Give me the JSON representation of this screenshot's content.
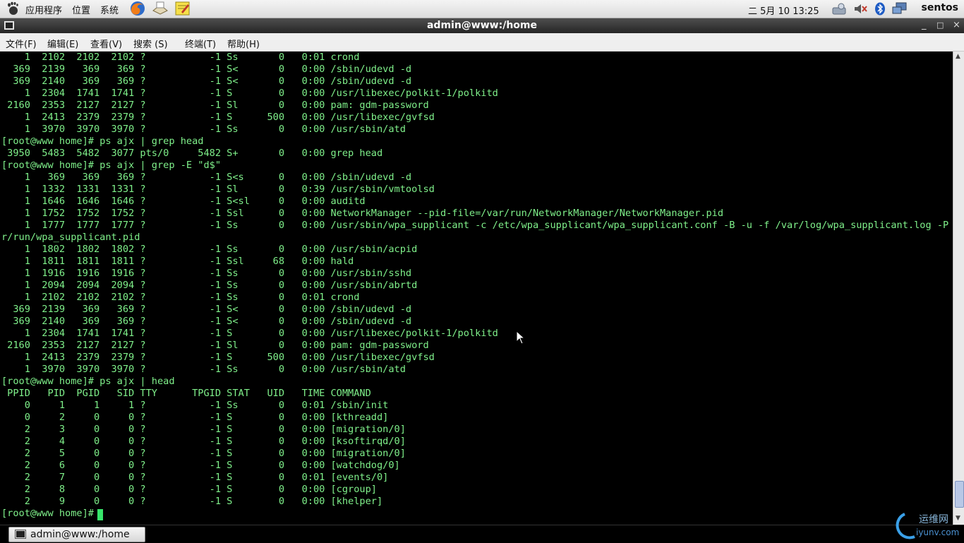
{
  "top_panel": {
    "menus": [
      "应用程序",
      "位置",
      "系统"
    ],
    "clock": "二 5月 10 13:25",
    "user": "sentos"
  },
  "window": {
    "title": "admin@www:/home",
    "controls": [
      "_",
      "□",
      "×"
    ]
  },
  "menubar": {
    "items": [
      "文件(F)",
      "编辑(E)",
      "查看(V)",
      "搜索 (S)",
      "终端(T)",
      "帮助(H)"
    ]
  },
  "terminal": {
    "lines": [
      "    1  2102  2102  2102 ?           -1 Ss       0   0:01 crond",
      "  369  2139   369   369 ?           -1 S<       0   0:00 /sbin/udevd -d",
      "  369  2140   369   369 ?           -1 S<       0   0:00 /sbin/udevd -d",
      "    1  2304  1741  1741 ?           -1 S        0   0:00 /usr/libexec/polkit-1/polkitd",
      " 2160  2353  2127  2127 ?           -1 Sl       0   0:00 pam: gdm-password",
      "    1  2413  2379  2379 ?           -1 S      500   0:00 /usr/libexec/gvfsd",
      "    1  3970  3970  3970 ?           -1 Ss       0   0:00 /usr/sbin/atd",
      "[root@www home]# ps ajx | grep head",
      " 3950  5483  5482  3077 pts/0     5482 S+       0   0:00 grep head",
      "[root@www home]# ps ajx | grep -E \"d$\"",
      "    1   369   369   369 ?           -1 S<s      0   0:00 /sbin/udevd -d",
      "    1  1332  1331  1331 ?           -1 Sl       0   0:39 /usr/sbin/vmtoolsd",
      "    1  1646  1646  1646 ?           -1 S<sl     0   0:00 auditd",
      "    1  1752  1752  1752 ?           -1 Ssl      0   0:00 NetworkManager --pid-file=/var/run/NetworkManager/NetworkManager.pid",
      "    1  1777  1777  1777 ?           -1 Ss       0   0:00 /usr/sbin/wpa_supplicant -c /etc/wpa_supplicant/wpa_supplicant.conf -B -u -f /var/log/wpa_supplicant.log -P /va",
      "r/run/wpa_supplicant.pid",
      "    1  1802  1802  1802 ?           -1 Ss       0   0:00 /usr/sbin/acpid",
      "    1  1811  1811  1811 ?           -1 Ssl     68   0:00 hald",
      "    1  1916  1916  1916 ?           -1 Ss       0   0:00 /usr/sbin/sshd",
      "    1  2094  2094  2094 ?           -1 Ss       0   0:00 /usr/sbin/abrtd",
      "    1  2102  2102  2102 ?           -1 Ss       0   0:01 crond",
      "  369  2139   369   369 ?           -1 S<       0   0:00 /sbin/udevd -d",
      "  369  2140   369   369 ?           -1 S<       0   0:00 /sbin/udevd -d",
      "    1  2304  1741  1741 ?           -1 S        0   0:00 /usr/libexec/polkit-1/polkitd",
      " 2160  2353  2127  2127 ?           -1 Sl       0   0:00 pam: gdm-password",
      "    1  2413  2379  2379 ?           -1 S      500   0:00 /usr/libexec/gvfsd",
      "    1  3970  3970  3970 ?           -1 Ss       0   0:00 /usr/sbin/atd",
      "[root@www home]# ps ajx | head",
      " PPID   PID  PGID   SID TTY      TPGID STAT   UID   TIME COMMAND",
      "    0     1     1     1 ?           -1 Ss       0   0:01 /sbin/init",
      "    0     2     0     0 ?           -1 S        0   0:00 [kthreadd]",
      "    2     3     0     0 ?           -1 S        0   0:00 [migration/0]",
      "    2     4     0     0 ?           -1 S        0   0:00 [ksoftirqd/0]",
      "    2     5     0     0 ?           -1 S        0   0:00 [migration/0]",
      "    2     6     0     0 ?           -1 S        0   0:00 [watchdog/0]",
      "    2     7     0     0 ?           -1 S        0   0:01 [events/0]",
      "    2     8     0     0 ?           -1 S        0   0:00 [cgroup]",
      "    2     9     0     0 ?           -1 S        0   0:00 [khelper]",
      "[root@www home]# "
    ]
  },
  "taskbar": {
    "item_label": "admin@www:/home"
  },
  "watermark": {
    "text": "运维网",
    "subtext": "iyunv.com"
  },
  "colors": {
    "terminal_fg": "#7ff08a",
    "terminal_bg": "#000000",
    "cursor": "#37e56a"
  }
}
